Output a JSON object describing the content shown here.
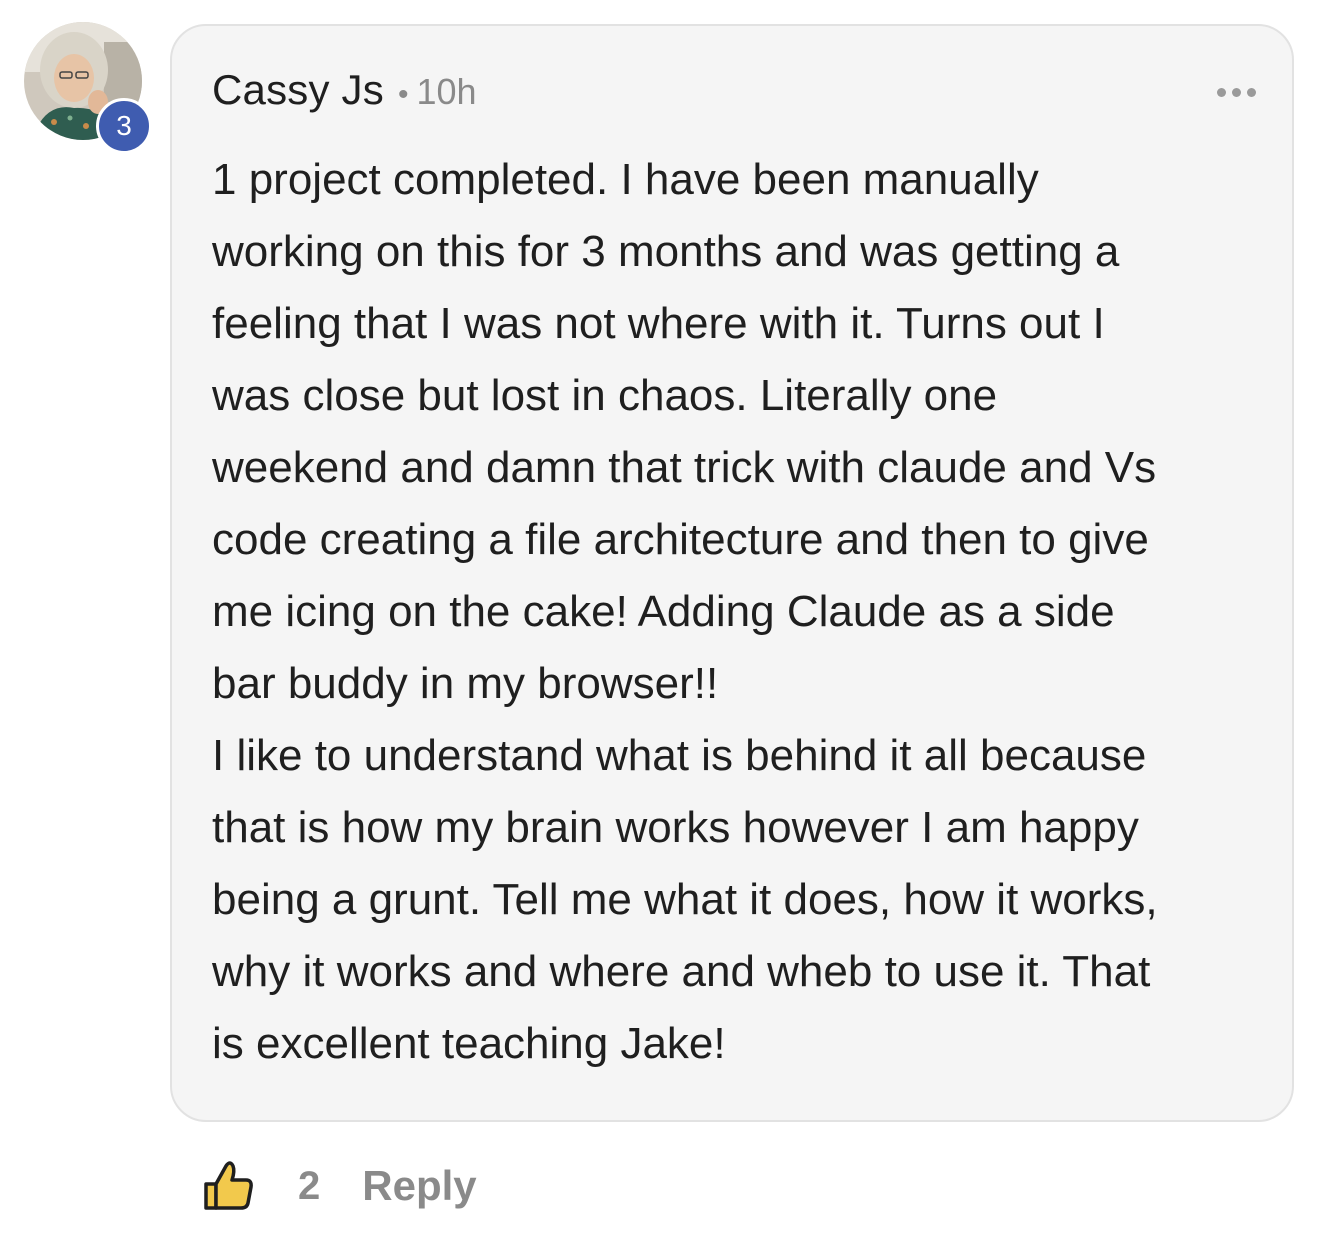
{
  "comment": {
    "author": "Cassy Js",
    "separator": "•",
    "time_ago": "10h",
    "level": "3",
    "text": "1 project completed. I have been manually\nworking on this for 3 months and was getting a\nfeeling that I was not where with it. Turns out I\nwas close but lost in chaos. Literally one\nweekend and damn that trick with claude and Vs\ncode creating a file architecture and then to give\nme icing on the cake! Adding Claude as a side\nbar buddy in my browser!!\nI like to understand what is behind it all because\nthat is how my brain works however I am happy\nbeing a grunt. Tell me what it does, how it works,\nwhy it works and where and wheb to use it. That\nis excellent teaching Jake!",
    "more_icon": "more-horizontal-icon"
  },
  "actions": {
    "like_icon": "thumbs-up-icon",
    "like_count": "2",
    "reply_label": "Reply"
  },
  "colors": {
    "level_badge": "#3f5cb0",
    "like_icon_fill": "#f2c94c",
    "bubble_bg": "#f5f5f5",
    "muted_text": "#8a8a8a"
  }
}
